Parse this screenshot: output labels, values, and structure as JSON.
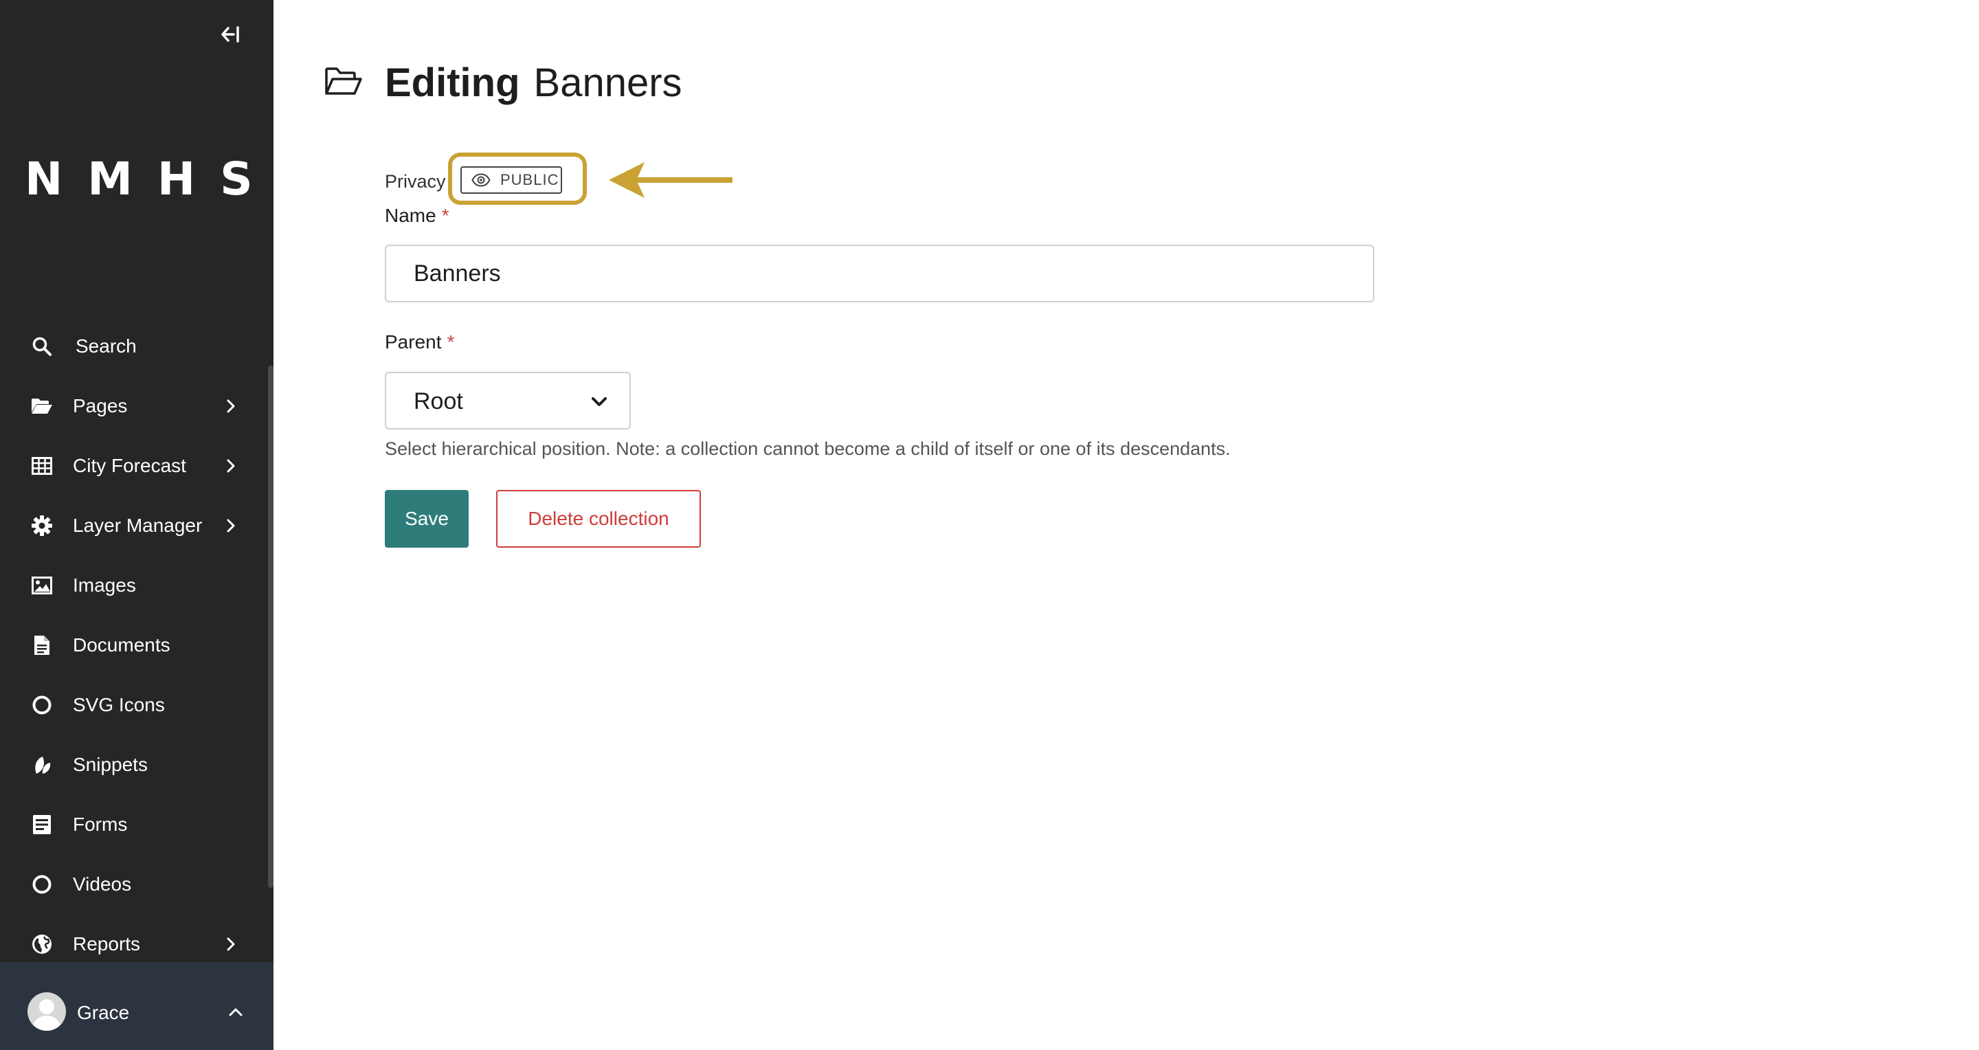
{
  "sidebar": {
    "collapse_icon": "collapse-left-icon",
    "logo": "NMHS",
    "items": [
      {
        "label": "Search",
        "icon": "search-icon",
        "has_submenu": false
      },
      {
        "label": "Pages",
        "icon": "folder-open-icon",
        "has_submenu": true
      },
      {
        "label": "City Forecast",
        "icon": "table-icon",
        "has_submenu": true
      },
      {
        "label": "Layer Manager",
        "icon": "gear-icon",
        "has_submenu": true
      },
      {
        "label": "Images",
        "icon": "image-icon",
        "has_submenu": false
      },
      {
        "label": "Documents",
        "icon": "document-icon",
        "has_submenu": false
      },
      {
        "label": "SVG Icons",
        "icon": "circle-icon",
        "has_submenu": false
      },
      {
        "label": "Snippets",
        "icon": "leaf-icon",
        "has_submenu": false
      },
      {
        "label": "Forms",
        "icon": "form-icon",
        "has_submenu": false
      },
      {
        "label": "Videos",
        "icon": "circle-icon",
        "has_submenu": false
      },
      {
        "label": "Reports",
        "icon": "globe-icon",
        "has_submenu": true
      }
    ],
    "account": {
      "name": "Grace"
    }
  },
  "header": {
    "title_strong": "Editing",
    "title_light": "Banners",
    "icon": "folder-open-icon"
  },
  "form": {
    "privacy_label": "Privacy",
    "privacy_badge": "PUBLIC",
    "name_label": "Name",
    "name_required": "*",
    "name_value": "Banners",
    "parent_label": "Parent",
    "parent_required": "*",
    "parent_value": "Root",
    "help_text": "Select hierarchical position. Note: a collection cannot become a child of itself or one of its descendants.",
    "save_label": "Save",
    "delete_label": "Delete collection"
  },
  "colors": {
    "sidebar_bg": "#262626",
    "highlight": "#c9a233",
    "primary": "#2e7d7b",
    "danger": "#cd3c3c"
  }
}
